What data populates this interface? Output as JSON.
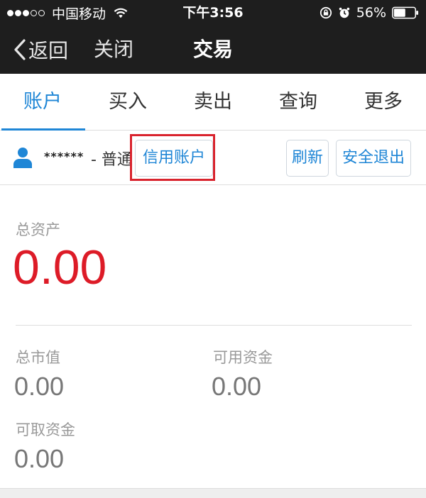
{
  "status_bar": {
    "carrier": "中国移动",
    "time": "下午3:56",
    "battery_percent": "56%",
    "battery_level": 0.56
  },
  "nav": {
    "back_label": "返回",
    "close_label": "关闭",
    "title": "交易"
  },
  "tabs": [
    {
      "label": "账户",
      "active": true
    },
    {
      "label": "买入"
    },
    {
      "label": "卖出"
    },
    {
      "label": "查询"
    },
    {
      "label": "更多"
    }
  ],
  "account": {
    "masked_name": "******",
    "type_label": "- 普通",
    "credit_button": "信用账户",
    "refresh_button": "刷新",
    "logout_button": "安全退出"
  },
  "assets": {
    "total_label": "总资产",
    "total_value": "0.00",
    "market_value_label": "总市值",
    "market_value": "0.00",
    "available_label": "可用资金",
    "available_value": "0.00",
    "withdrawable_label": "可取资金",
    "withdrawable_value": "0.00"
  },
  "colors": {
    "accent": "#1f86d6",
    "total_value": "#dd1b27",
    "highlight": "#d9232d",
    "bar_bg": "#1e1e1e"
  },
  "icons": [
    "wifi-icon",
    "orientation-lock-icon",
    "alarm-icon",
    "battery-icon",
    "chevron-left-icon",
    "user-icon"
  ]
}
